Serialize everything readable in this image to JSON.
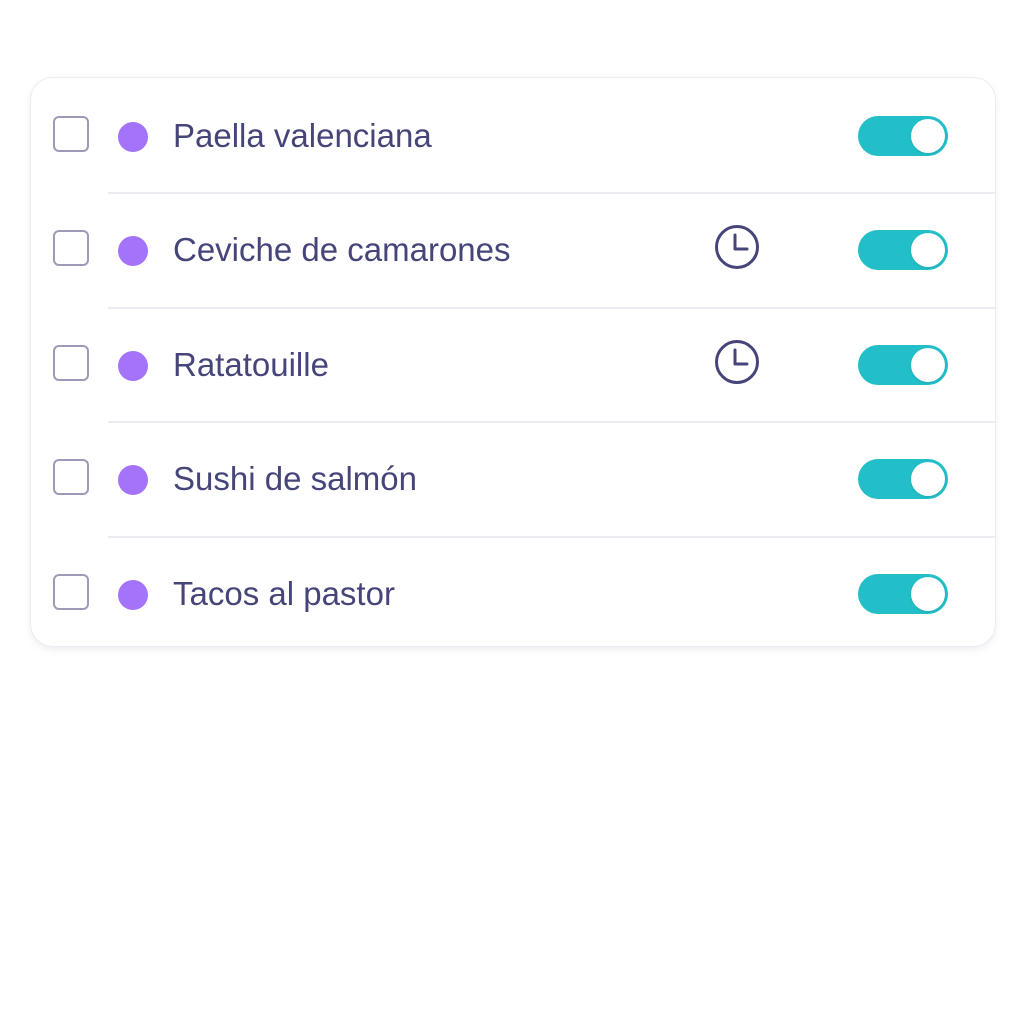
{
  "accent_color": "#22bfc8",
  "dot_color": "#a374fa",
  "items": [
    {
      "label": "Paella valenciana",
      "checked": false,
      "enabled": true,
      "clock_icon": false
    },
    {
      "label": "Ceviche de camarones",
      "checked": false,
      "enabled": true,
      "clock_icon": true
    },
    {
      "label": "Ratatouille",
      "checked": false,
      "enabled": true,
      "clock_icon": true
    },
    {
      "label": "Sushi de salmón",
      "checked": false,
      "enabled": true,
      "clock_icon": false
    },
    {
      "label": "Tacos al pastor",
      "checked": false,
      "enabled": true,
      "clock_icon": false
    }
  ],
  "icons": {
    "clock": "clock-icon",
    "status": "status-dot-icon"
  }
}
